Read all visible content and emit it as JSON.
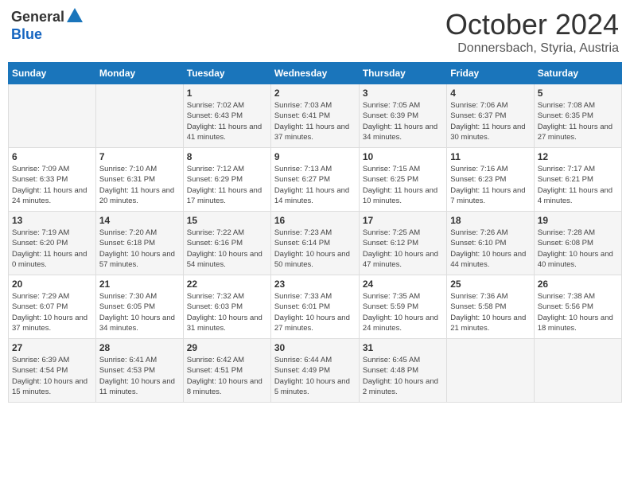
{
  "header": {
    "logo_general": "General",
    "logo_blue": "Blue",
    "month_title": "October 2024",
    "location": "Donnersbach, Styria, Austria"
  },
  "days_of_week": [
    "Sunday",
    "Monday",
    "Tuesday",
    "Wednesday",
    "Thursday",
    "Friday",
    "Saturday"
  ],
  "weeks": [
    [
      null,
      null,
      {
        "day": 1,
        "sunrise": "7:02 AM",
        "sunset": "6:43 PM",
        "daylight": "11 hours and 41 minutes."
      },
      {
        "day": 2,
        "sunrise": "7:03 AM",
        "sunset": "6:41 PM",
        "daylight": "11 hours and 37 minutes."
      },
      {
        "day": 3,
        "sunrise": "7:05 AM",
        "sunset": "6:39 PM",
        "daylight": "11 hours and 34 minutes."
      },
      {
        "day": 4,
        "sunrise": "7:06 AM",
        "sunset": "6:37 PM",
        "daylight": "11 hours and 30 minutes."
      },
      {
        "day": 5,
        "sunrise": "7:08 AM",
        "sunset": "6:35 PM",
        "daylight": "11 hours and 27 minutes."
      }
    ],
    [
      {
        "day": 6,
        "sunrise": "7:09 AM",
        "sunset": "6:33 PM",
        "daylight": "11 hours and 24 minutes."
      },
      {
        "day": 7,
        "sunrise": "7:10 AM",
        "sunset": "6:31 PM",
        "daylight": "11 hours and 20 minutes."
      },
      {
        "day": 8,
        "sunrise": "7:12 AM",
        "sunset": "6:29 PM",
        "daylight": "11 hours and 17 minutes."
      },
      {
        "day": 9,
        "sunrise": "7:13 AM",
        "sunset": "6:27 PM",
        "daylight": "11 hours and 14 minutes."
      },
      {
        "day": 10,
        "sunrise": "7:15 AM",
        "sunset": "6:25 PM",
        "daylight": "11 hours and 10 minutes."
      },
      {
        "day": 11,
        "sunrise": "7:16 AM",
        "sunset": "6:23 PM",
        "daylight": "11 hours and 7 minutes."
      },
      {
        "day": 12,
        "sunrise": "7:17 AM",
        "sunset": "6:21 PM",
        "daylight": "11 hours and 4 minutes."
      }
    ],
    [
      {
        "day": 13,
        "sunrise": "7:19 AM",
        "sunset": "6:20 PM",
        "daylight": "11 hours and 0 minutes."
      },
      {
        "day": 14,
        "sunrise": "7:20 AM",
        "sunset": "6:18 PM",
        "daylight": "10 hours and 57 minutes."
      },
      {
        "day": 15,
        "sunrise": "7:22 AM",
        "sunset": "6:16 PM",
        "daylight": "10 hours and 54 minutes."
      },
      {
        "day": 16,
        "sunrise": "7:23 AM",
        "sunset": "6:14 PM",
        "daylight": "10 hours and 50 minutes."
      },
      {
        "day": 17,
        "sunrise": "7:25 AM",
        "sunset": "6:12 PM",
        "daylight": "10 hours and 47 minutes."
      },
      {
        "day": 18,
        "sunrise": "7:26 AM",
        "sunset": "6:10 PM",
        "daylight": "10 hours and 44 minutes."
      },
      {
        "day": 19,
        "sunrise": "7:28 AM",
        "sunset": "6:08 PM",
        "daylight": "10 hours and 40 minutes."
      }
    ],
    [
      {
        "day": 20,
        "sunrise": "7:29 AM",
        "sunset": "6:07 PM",
        "daylight": "10 hours and 37 minutes."
      },
      {
        "day": 21,
        "sunrise": "7:30 AM",
        "sunset": "6:05 PM",
        "daylight": "10 hours and 34 minutes."
      },
      {
        "day": 22,
        "sunrise": "7:32 AM",
        "sunset": "6:03 PM",
        "daylight": "10 hours and 31 minutes."
      },
      {
        "day": 23,
        "sunrise": "7:33 AM",
        "sunset": "6:01 PM",
        "daylight": "10 hours and 27 minutes."
      },
      {
        "day": 24,
        "sunrise": "7:35 AM",
        "sunset": "5:59 PM",
        "daylight": "10 hours and 24 minutes."
      },
      {
        "day": 25,
        "sunrise": "7:36 AM",
        "sunset": "5:58 PM",
        "daylight": "10 hours and 21 minutes."
      },
      {
        "day": 26,
        "sunrise": "7:38 AM",
        "sunset": "5:56 PM",
        "daylight": "10 hours and 18 minutes."
      }
    ],
    [
      {
        "day": 27,
        "sunrise": "6:39 AM",
        "sunset": "4:54 PM",
        "daylight": "10 hours and 15 minutes."
      },
      {
        "day": 28,
        "sunrise": "6:41 AM",
        "sunset": "4:53 PM",
        "daylight": "10 hours and 11 minutes."
      },
      {
        "day": 29,
        "sunrise": "6:42 AM",
        "sunset": "4:51 PM",
        "daylight": "10 hours and 8 minutes."
      },
      {
        "day": 30,
        "sunrise": "6:44 AM",
        "sunset": "4:49 PM",
        "daylight": "10 hours and 5 minutes."
      },
      {
        "day": 31,
        "sunrise": "6:45 AM",
        "sunset": "4:48 PM",
        "daylight": "10 hours and 2 minutes."
      },
      null,
      null
    ]
  ]
}
